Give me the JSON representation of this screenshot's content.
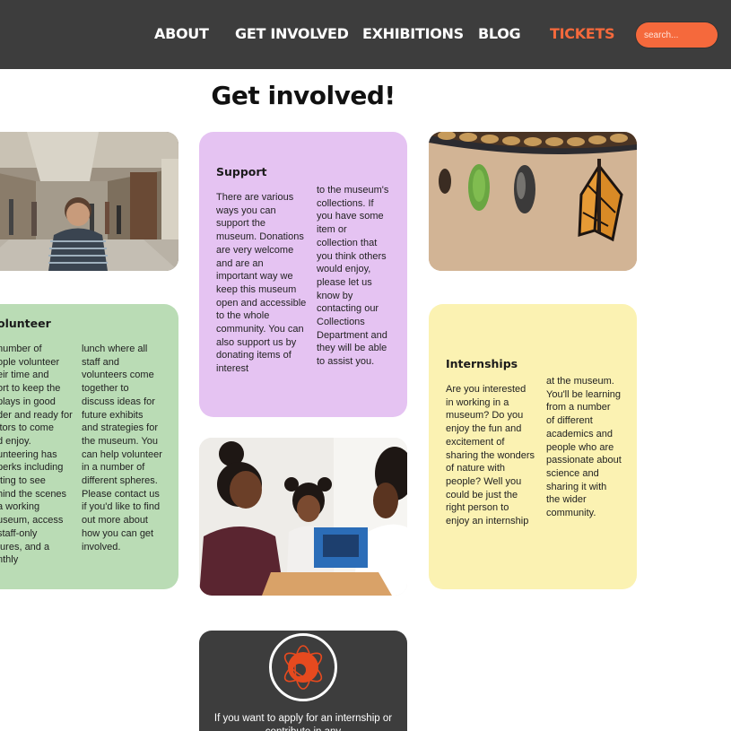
{
  "nav": {
    "items": [
      {
        "label": "ABOUT"
      },
      {
        "label": "GET INVOLVED"
      },
      {
        "label": "EXHIBITIONS"
      },
      {
        "label": "BLOG"
      },
      {
        "label": "TICKETS",
        "active": true
      }
    ],
    "search_placeholder": "search..."
  },
  "page": {
    "title": "Get involved!"
  },
  "support": {
    "title": "Support",
    "col1": "There are various\nways you can\nsupport the\nmuseum. Donations\nare very welcome\nand are an\nimportant way we\nkeep this museum\nopen and accessible\nto the whole\ncommunity. You can\nalso support us by\ndonating items of\ninterest",
    "col2": "to the museum's\ncollections. If\nyou have some\nitem or\ncollection that\nyou think others\nwould enjoy,\nplease let us\nknow by\ncontacting our\nCollections\nDepartment and\nthey will be able\nto assist you."
  },
  "volunteer": {
    "title": "olunteer",
    "col1": "number of\nople volunteer\neir time and\nort to keep the\nplays in good\nder and ready for\nitors to come\nd enjoy.\nunteering has\nperks including\ntting to see\nhind the scenes\na working\nuseum, access\nstaff-only\ntures, and a\nnthly",
    "col2": "lunch where all\nstaff and\nvolunteers come\ntogether to\ndiscuss ideas for\nfuture exhibits\nand strategies for\nthe museum. You\ncan help volunteer\nin a number of\ndifferent spheres.\nPlease contact us\nif you'd like to find\nout more about\nhow you can get\ninvolved."
  },
  "internships": {
    "title": "Internships",
    "col1": "Are you interested\nin working in a\nmuseum? Do you\nenjoy the fun and\nexcitement of\nsharing the wonders\nof nature with\npeople? Well you\ncould be just the\nright person to\nenjoy an internship",
    "col2": "at the museum.\nYou'll be learning\nfrom a number\nof different\nacademics and\npeople who are\npassionate about\nscience and\nsharing it with\nthe wider\ncommunity."
  },
  "cta": {
    "text": "If you want to apply for an internship or\ncontribute in any"
  },
  "colors": {
    "nav_bg": "#3d3d3d",
    "accent": "#f5693c",
    "support_bg": "#e5c3f2",
    "volunteer_bg": "#badcb5",
    "intern_bg": "#fbf2b2"
  },
  "icons": [
    "atom-logo-icon"
  ]
}
